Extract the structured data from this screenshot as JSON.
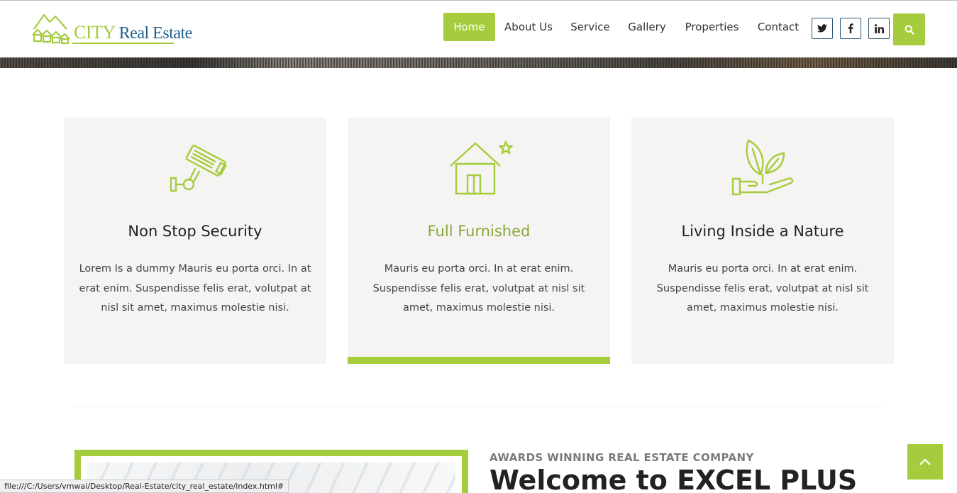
{
  "brand": {
    "word1": "CITY",
    "word2": "Real Estate",
    "accent": "#a5cc3c",
    "secondary": "#1f5f8b"
  },
  "nav": {
    "items": [
      {
        "label": "Home",
        "active": true
      },
      {
        "label": "About Us",
        "active": false
      },
      {
        "label": "Service",
        "active": false
      },
      {
        "label": "Gallery",
        "active": false
      },
      {
        "label": "Properties",
        "active": false
      },
      {
        "label": "Contact",
        "active": false
      }
    ],
    "social": [
      {
        "icon": "twitter-icon"
      },
      {
        "icon": "facebook-icon"
      },
      {
        "icon": "linkedin-icon"
      }
    ],
    "search_icon": "search-icon"
  },
  "features": [
    {
      "icon": "security-camera-icon",
      "title": "Non Stop Security",
      "text": "Lorem Is a dummy Mauris eu porta orci. In at erat enim. Suspendisse felis erat, volutpat at nisl sit amet, maximus molestie nisi.",
      "highlighted": false
    },
    {
      "icon": "house-star-icon",
      "title": "Full Furnished",
      "text": "Mauris eu porta orci. In at erat enim. Suspendisse felis erat, volutpat at nisl sit amet, maximus molestie nisi.",
      "highlighted": true
    },
    {
      "icon": "hand-plant-icon",
      "title": "Living Inside a Nature",
      "text": "Mauris eu porta orci. In at erat enim. Suspendisse felis erat, volutpat at nisl sit amet, maximus molestie nisi.",
      "highlighted": false
    }
  ],
  "about": {
    "eyebrow": "AWARDS WINNING REAL ESTATE COMPANY",
    "title": "Welcome to EXCEL PLUS"
  },
  "status_bar": {
    "url": "file:///C:/Users/vmwai/Desktop/Real-Estate/city_real_estate/index.html#"
  },
  "back_to_top": {
    "icon": "chevron-up-icon"
  }
}
